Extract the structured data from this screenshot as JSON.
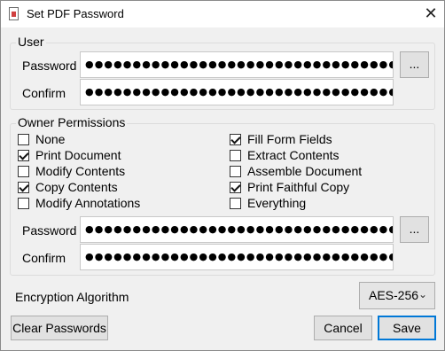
{
  "window": {
    "title": "Set PDF Password",
    "close_glyph": "✕",
    "icon": "pdf-document-icon"
  },
  "user_group": {
    "label": "User",
    "password_label": "Password",
    "password_value": "●●●●●●●●●●●●●●●●●●●●●●●●●●●●●●●●●●",
    "browse_label": "...",
    "confirm_label": "Confirm",
    "confirm_value": "●●●●●●●●●●●●●●●●●●●●●●●●●●●●●●●●●●"
  },
  "owner_group": {
    "label": "Owner Permissions",
    "permissions": [
      {
        "label": "None",
        "checked": false
      },
      {
        "label": "Print Document",
        "checked": true
      },
      {
        "label": "Modify Contents",
        "checked": false
      },
      {
        "label": "Copy Contents",
        "checked": true
      },
      {
        "label": "Modify Annotations",
        "checked": false
      },
      {
        "label": "Fill Form Fields",
        "checked": true
      },
      {
        "label": "Extract Contents",
        "checked": false
      },
      {
        "label": "Assemble Document",
        "checked": false
      },
      {
        "label": "Print Faithful Copy",
        "checked": true
      },
      {
        "label": "Everything",
        "checked": false
      }
    ],
    "password_label": "Password",
    "password_value": "●●●●●●●●●●●●●●●●●●●●●●●●●●●●●●●●●●",
    "browse_label": "...",
    "confirm_label": "Confirm",
    "confirm_value": "●●●●●●●●●●●●●●●●●●●●●●●●●●●●●●●●●●"
  },
  "encryption": {
    "label": "Encryption Algorithm",
    "selected": "AES-256",
    "arrow": "⌄"
  },
  "buttons": {
    "clear": "Clear Passwords",
    "cancel": "Cancel",
    "save": "Save"
  }
}
